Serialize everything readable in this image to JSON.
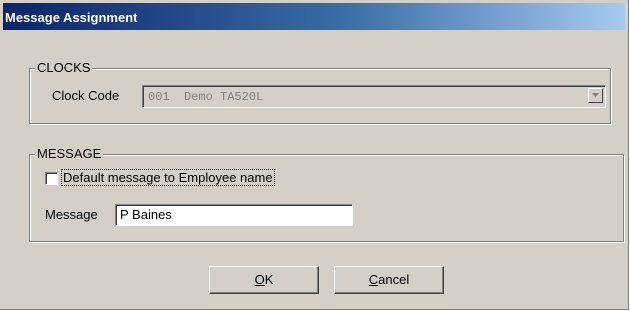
{
  "window": {
    "title": "Message Assignment"
  },
  "clocks": {
    "group_label": "CLOCKS",
    "clock_code_label": "Clock Code",
    "clock_code_value": "001  Demo TA520L"
  },
  "message": {
    "group_label": "MESSAGE",
    "default_checkbox_label": "Default message to Employee name",
    "default_checked": false,
    "message_label": "Message",
    "message_value": "P Baines"
  },
  "buttons": {
    "ok": {
      "accel": "O",
      "rest": "K"
    },
    "cancel": {
      "accel": "C",
      "rest": "ancel"
    }
  },
  "colors": {
    "face": "#d4d0c8",
    "title_start": "#0a246a",
    "title_end": "#a6caf0"
  },
  "icons": {
    "dropdown": "chevron-down-icon"
  }
}
